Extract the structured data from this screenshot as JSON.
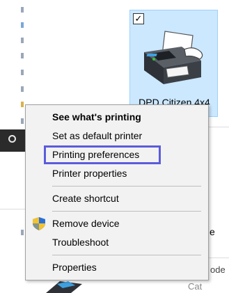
{
  "tile": {
    "printer_name": "DPD Citizen 4x4",
    "checked": true
  },
  "menu": {
    "items": [
      {
        "label": "See what's printing",
        "bold": true
      },
      {
        "label": "Set as default printer"
      },
      {
        "label": "Printing preferences",
        "highlighted": true
      },
      {
        "label": "Printer properties"
      },
      {
        "label": "Create shortcut"
      },
      {
        "label": "Remove device",
        "icon": "uac-shield-icon"
      },
      {
        "label": "Troubleshoot"
      },
      {
        "label": "Properties"
      }
    ]
  },
  "background_fragments": {
    "right_e": "e",
    "right_ode": "ode",
    "right_cat": "Cat"
  },
  "colors": {
    "tile_bg": "#cce8ff",
    "tile_border": "#99d1ff",
    "highlight_border": "#5b5bdc",
    "menu_bg": "#f2f2f2"
  }
}
